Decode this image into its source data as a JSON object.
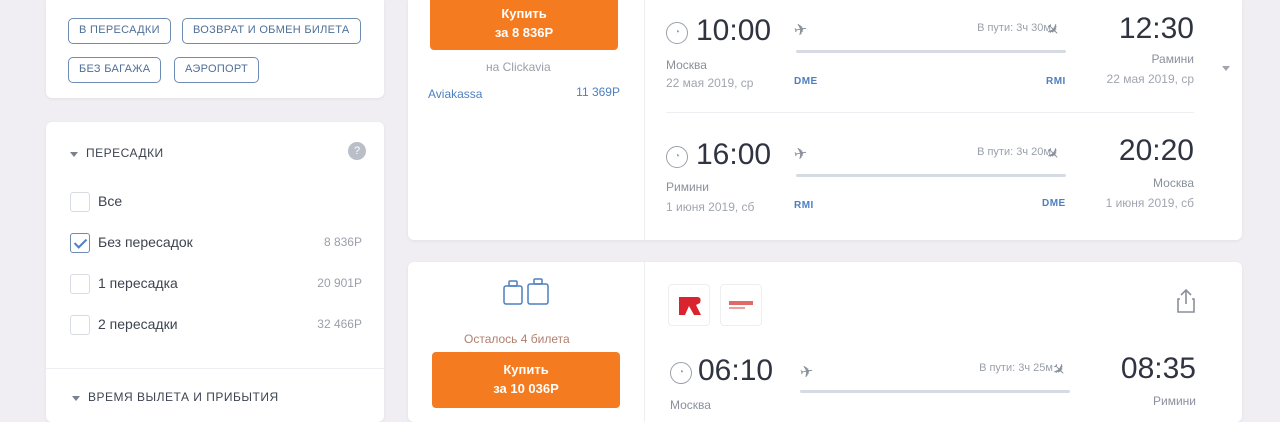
{
  "filters": {
    "chips": [
      "В пересадки",
      "Возврат и обмен билета",
      "Без багажа",
      "Аэропорт"
    ]
  },
  "transfers": {
    "title": "Пересадки",
    "options": [
      {
        "label": "Все",
        "price": "",
        "checked": false
      },
      {
        "label": "Без пересадок",
        "price": "8 836Р",
        "checked": true
      },
      {
        "label": "1 пересадка",
        "price": "20 901Р",
        "checked": false
      },
      {
        "label": "2 пересадки",
        "price": "32 466Р",
        "checked": false
      }
    ],
    "next_section": "Время вылета и прибытия"
  },
  "ticket1": {
    "buy_label": "Купить",
    "buy_price": "за 8 836Р",
    "source": "на Clickavia",
    "agency": "Aviakassa",
    "agency_price": "11 369Р",
    "legs": [
      {
        "dep_time": "10:00",
        "arr_time": "12:30",
        "dep_city": "Москва",
        "arr_city": "Рамини",
        "dep_date": "22 мая 2019, ср",
        "arr_date": "22 мая 2019, ср",
        "dep_airport": "DME",
        "arr_airport": "RMI",
        "duration": "В пути: 3ч 30м"
      },
      {
        "dep_time": "16:00",
        "arr_time": "20:20",
        "dep_city": "Римини",
        "arr_city": "Москва",
        "dep_date": "1 июня 2019, сб",
        "arr_date": "1 июня 2019, сб",
        "dep_airport": "RMI",
        "arr_airport": "DME",
        "duration": "В пути: 3ч 20м"
      }
    ]
  },
  "ticket2": {
    "seats_left": "Осталось 4 билета",
    "buy_label": "Купить",
    "buy_price": "за 10 036Р",
    "leg": {
      "dep_time": "06:10",
      "arr_time": "08:35",
      "dep_city": "Москва",
      "arr_city": "Римини",
      "duration": "В пути: 3ч 25м"
    }
  },
  "colors": {
    "accent": "#f47b20",
    "link": "#4d7fc0",
    "chip_border": "#6d8cb2"
  }
}
